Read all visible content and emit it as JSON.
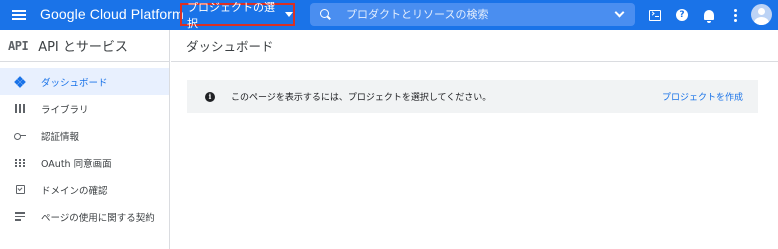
{
  "topbar": {
    "brand": "Google Cloud Platform",
    "project_select_label": "プロジェクトの選択",
    "search_placeholder": "プロダクトとリソースの検索",
    "accent_color": "#1a73e8",
    "highlight_color": "#d93025",
    "icons": [
      "menu-icon",
      "search-icon",
      "chevron-down-icon",
      "cloud-shell-icon",
      "help-icon",
      "notifications-icon",
      "more-vert-icon",
      "account-avatar"
    ]
  },
  "sidebar": {
    "logo": "API",
    "title": "API とサービス",
    "items": [
      {
        "label": "ダッシュボード",
        "icon": "dashboard-icon",
        "active": true
      },
      {
        "label": "ライブラリ",
        "icon": "library-icon",
        "active": false
      },
      {
        "label": "認証情報",
        "icon": "key-icon",
        "active": false
      },
      {
        "label": "OAuth 同意画面",
        "icon": "oauth-icon",
        "active": false
      },
      {
        "label": "ドメインの確認",
        "icon": "domain-check-icon",
        "active": false
      },
      {
        "label": "ページの使用に関する契約",
        "icon": "terms-icon",
        "active": false
      }
    ]
  },
  "main": {
    "title": "ダッシュボード",
    "notice": {
      "icon": "info-icon",
      "text": "このページを表示するには、プロジェクトを選択してください。",
      "link": "プロジェクトを作成"
    }
  }
}
